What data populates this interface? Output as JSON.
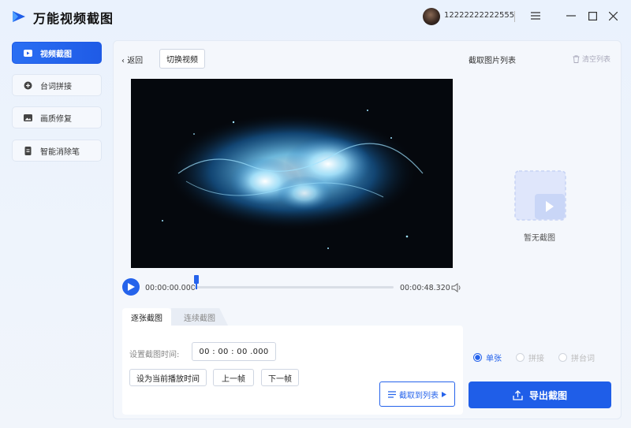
{
  "app": {
    "title": "万能视频截图"
  },
  "user": {
    "name": "12222222222555"
  },
  "window": {
    "menu_icon": "hamburger-icon",
    "minimize_icon": "minimize-icon",
    "maximize_icon": "maximize-icon",
    "close_icon": "close-icon"
  },
  "sidebar": {
    "items": [
      {
        "label": "视频截图",
        "icon": "video-icon",
        "active": true
      },
      {
        "label": "台词拼接",
        "icon": "plus-circle-icon",
        "active": false
      },
      {
        "label": "画质修复",
        "icon": "image-icon",
        "active": false
      },
      {
        "label": "智能消除笔",
        "icon": "document-icon",
        "active": false
      }
    ]
  },
  "toolbar": {
    "back_label": "返回",
    "switch_label": "切换视频"
  },
  "player": {
    "current_time": "00:00:00.000",
    "total_time": "00:00:48.320",
    "progress": 0.01
  },
  "tabs": [
    {
      "label": "逐张截图",
      "active": true
    },
    {
      "label": "连续截图",
      "active": false
    }
  ],
  "capture": {
    "set_time_label": "设置截图时间:",
    "time_value": "00 : 00 : 00 .000",
    "set_current_label": "设为当前播放时间",
    "prev_frame_label": "上一帧",
    "next_frame_label": "下一帧",
    "capture_to_list_label": "截取到列表"
  },
  "list": {
    "title": "截取图片列表",
    "clear_label": "清空列表",
    "empty_label": "暂无截图"
  },
  "modes": [
    {
      "label": "单张",
      "selected": true
    },
    {
      "label": "拼接",
      "selected": false
    },
    {
      "label": "拼台词",
      "selected": false
    }
  ],
  "export": {
    "label": "导出截图"
  },
  "colors": {
    "accent": "#1f5ee8",
    "background": "#eaf2fd"
  }
}
